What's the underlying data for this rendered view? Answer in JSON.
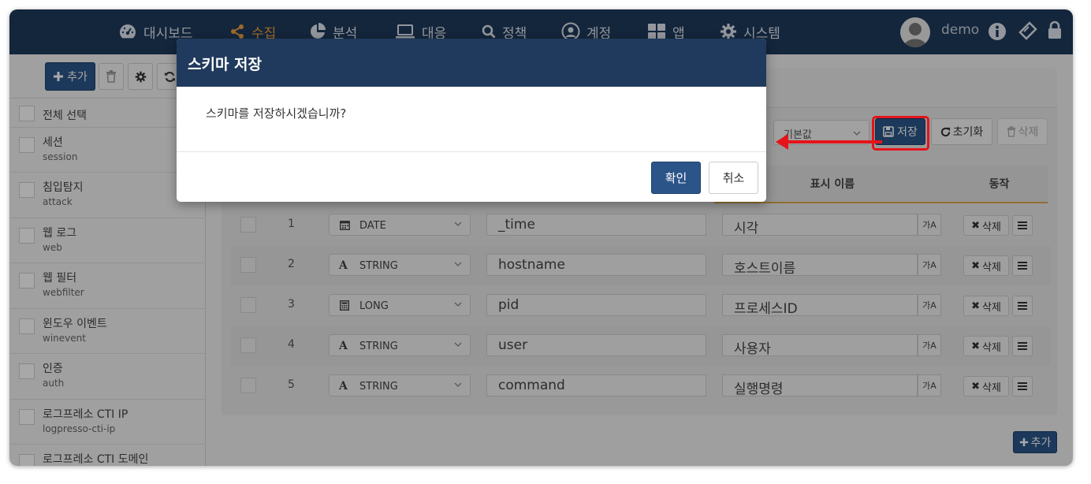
{
  "nav": {
    "items": [
      {
        "label": "대시보드",
        "icon": "dashboard-icon"
      },
      {
        "label": "수집",
        "icon": "share-icon",
        "active": true
      },
      {
        "label": "분석",
        "icon": "pie-chart-icon"
      },
      {
        "label": "대응",
        "icon": "laptop-icon"
      },
      {
        "label": "정책",
        "icon": "search-icon"
      },
      {
        "label": "계정",
        "icon": "user-circle-icon"
      },
      {
        "label": "앱",
        "icon": "grid-icon"
      },
      {
        "label": "시스템",
        "icon": "gear-icon"
      }
    ],
    "username": "demo",
    "active_color": "#f0a040",
    "bar_color": "#1f3a5c"
  },
  "sidebar": {
    "add_label": "추가",
    "items": [
      {
        "name": "전체 선택",
        "code": ""
      },
      {
        "name": "세션",
        "code": "session"
      },
      {
        "name": "침입탐지",
        "code": "attack"
      },
      {
        "name": "웹 로그",
        "code": "web"
      },
      {
        "name": "웹 필터",
        "code": "webfilter"
      },
      {
        "name": "윈도우 이벤트",
        "code": "winevent"
      },
      {
        "name": "인증",
        "code": "auth"
      },
      {
        "name": "로그프레소 CTI IP",
        "code": "logpresso-cti-ip"
      },
      {
        "name": "로그프레소 CTI 도메인",
        "code": ""
      }
    ]
  },
  "toolbar": {
    "default_select": "기본값",
    "save_label": "저장",
    "reset_label": "초기화",
    "delete_label": "삭제"
  },
  "table": {
    "headers": {
      "display_name": "표시 이름",
      "action": "동작"
    },
    "rows": [
      {
        "num": "1",
        "type": "DATE",
        "type_icon": "calendar-icon",
        "field": "_time",
        "display": "시각"
      },
      {
        "num": "2",
        "type": "STRING",
        "type_icon": "text-a-icon",
        "field": "hostname",
        "display": "호스트이름"
      },
      {
        "num": "3",
        "type": "LONG",
        "type_icon": "calculator-icon",
        "field": "pid",
        "display": "프로세스ID"
      },
      {
        "num": "4",
        "type": "STRING",
        "type_icon": "text-a-icon",
        "field": "user",
        "display": "사용자"
      },
      {
        "num": "5",
        "type": "STRING",
        "type_icon": "text-a-icon",
        "field": "command",
        "display": "실행명령"
      }
    ],
    "row_delete_label": "삭제",
    "translate_label": "가A",
    "add_label": "추가"
  },
  "modal": {
    "title": "스키마 저장",
    "message": "스키마를 저장하시겠습니까?",
    "ok_label": "확인",
    "cancel_label": "취소"
  },
  "annotation": {
    "color": "#e4141a"
  }
}
